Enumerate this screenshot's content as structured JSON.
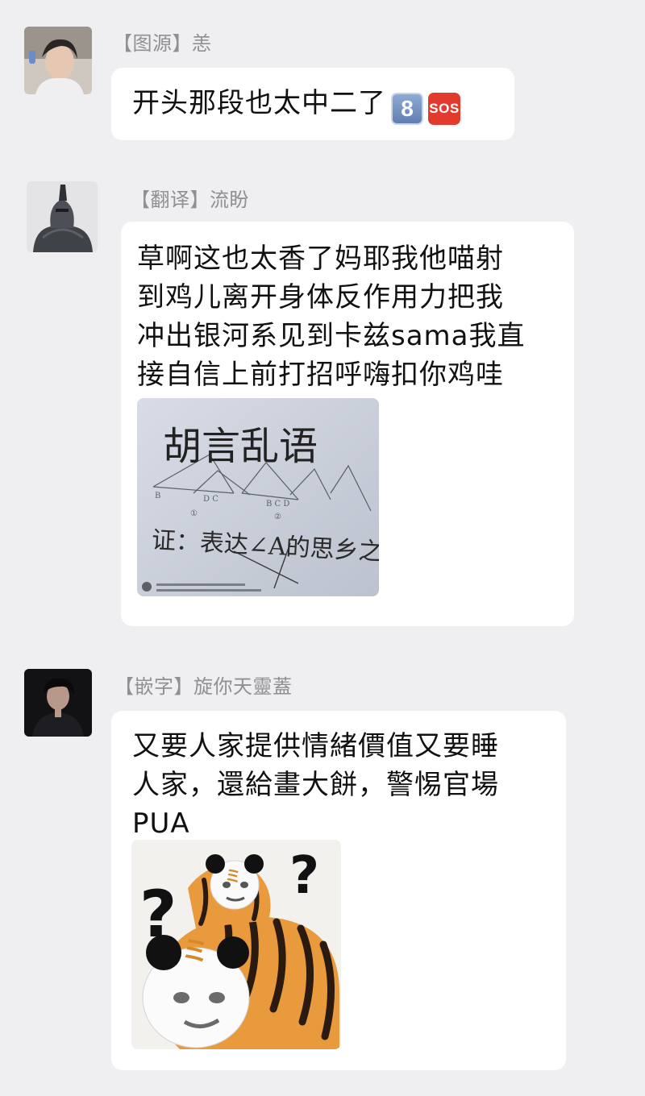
{
  "messages": [
    {
      "tag": "【图源】",
      "name": "恙",
      "text": "开头那段也太中二了",
      "emojis": [
        "8",
        "SOS"
      ]
    },
    {
      "tag": "【翻译】",
      "name": "流盼",
      "text": "草啊这也太香了妈耶我他喵射\n到鸡儿离开身体反作用力把我\n冲出银河系见到卡兹sama我直\n接自信上前打招呼嗨扣你鸡哇",
      "sticker": {
        "caption": "胡言乱语",
        "handwriting": "证：表达∠A的思乡之情。"
      }
    },
    {
      "tag": "【嵌字】",
      "name": "旋你天靈蓋",
      "text": "又要人家提供情緒價值又要睡\n人家，還給畫大餅，警惕官場\nPUA",
      "sticker": {
        "marks": [
          "?",
          "?",
          "ミ",
          "ミ"
        ]
      }
    }
  ],
  "colors": {
    "background": "#efeff1",
    "bubble": "#ffffff",
    "sender": "#8f8f94",
    "text": "#111111"
  }
}
